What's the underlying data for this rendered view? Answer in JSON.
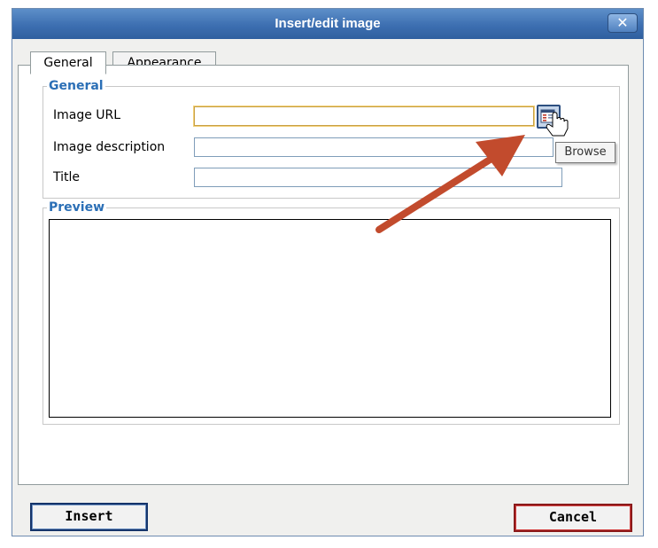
{
  "dialog": {
    "title": "Insert/edit image",
    "close_symbol": "✕"
  },
  "tabs": [
    {
      "label": "General",
      "active": true
    },
    {
      "label": "Appearance",
      "active": false
    }
  ],
  "general_section": {
    "legend": "General",
    "fields": {
      "image_url": {
        "label": "Image URL",
        "value": ""
      },
      "image_description": {
        "label": "Image description",
        "value": ""
      },
      "title": {
        "label": "Title",
        "value": ""
      }
    },
    "browse": {
      "icon": "browse-icon",
      "tooltip": "Browse"
    }
  },
  "preview_section": {
    "legend": "Preview"
  },
  "buttons": {
    "insert": "Insert",
    "cancel": "Cancel"
  },
  "annotation": {
    "icon": "arrow-icon",
    "color": "#c24b2d"
  },
  "colors": {
    "titlebar": "#3d6fb1",
    "legend": "#2b6fb6",
    "cancel_border": "#8a1a1a",
    "insert_border": "#15346a"
  }
}
